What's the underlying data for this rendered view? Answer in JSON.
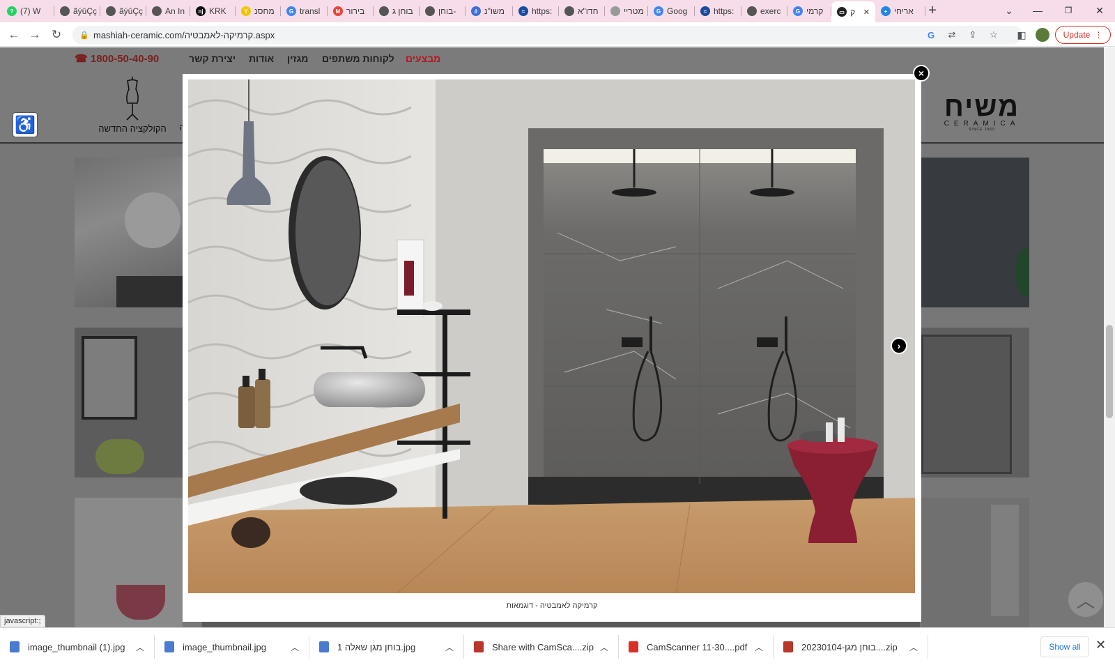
{
  "tabs": [
    {
      "title": "(7) W",
      "color": "#25d366",
      "glyph": "?"
    },
    {
      "title": "ãýûÇç",
      "color": "#555555",
      "glyph": ""
    },
    {
      "title": "ãýûÇç",
      "color": "#555555",
      "glyph": ""
    },
    {
      "title": "An In",
      "color": "#555555",
      "glyph": ""
    },
    {
      "title": "KRK",
      "color": "#111111",
      "glyph": "nj"
    },
    {
      "title": "מחסנ",
      "color": "#f2c500",
      "glyph": "Y"
    },
    {
      "title": "transl",
      "color": "#4285f4",
      "glyph": "G"
    },
    {
      "title": "בירור",
      "color": "#ea4335",
      "glyph": "M"
    },
    {
      "title": "בוחן ג",
      "color": "#555555",
      "glyph": ""
    },
    {
      "title": "בוחן-",
      "color": "#555555",
      "glyph": ""
    },
    {
      "title": "משו\"נ",
      "color": "#3f6fd8",
      "glyph": "∂"
    },
    {
      "title": "https:",
      "color": "#1a4b9c",
      "glyph": "≈"
    },
    {
      "title": "חדו\"א",
      "color": "#555555",
      "glyph": ""
    },
    {
      "title": "מטריי",
      "color": "#999999",
      "glyph": ""
    },
    {
      "title": "Goog",
      "color": "#4285f4",
      "glyph": "G"
    },
    {
      "title": "https:",
      "color": "#1a4b9c",
      "glyph": "≈"
    },
    {
      "title": "exerc",
      "color": "#555555",
      "glyph": ""
    },
    {
      "title": "קרמי",
      "color": "#4285f4",
      "glyph": "G"
    },
    {
      "title": "ק",
      "color": "#222222",
      "glyph": "▭",
      "active": true
    },
    {
      "title": "אריחי",
      "color": "#1e88e5",
      "glyph": "+"
    }
  ],
  "window": {
    "new_tab": "+",
    "tab_list": "⌄",
    "minimize": "—",
    "maximize": "❐",
    "close": "✕"
  },
  "browser": {
    "url": "mashiah-ceramic.com/קרמיקה-לאמבטיה.aspx",
    "update_label": "Update",
    "status_text": "javascript:;"
  },
  "site": {
    "phone": "☎ 1800-50-40-90",
    "nav": [
      "יצירת קשר",
      "אודות",
      "מגזין",
      "לקוחות משתפים",
      "מבצעים"
    ],
    "nav_highlight_color": "#b5171d",
    "collection_label": "הקולקציה החדשה",
    "logo_text": "משיח",
    "logo_sub": "CERAMICA",
    "logo_since": "SINCE 1960",
    "peek_char": "ה"
  },
  "lightbox": {
    "caption": "קרמיקה לאמבטיה - דוגמאות",
    "close_icon": "×",
    "next_icon": "›"
  },
  "downloads": {
    "items": [
      {
        "name": "image_thumbnail (1).jpg",
        "type": "jpg"
      },
      {
        "name": "image_thumbnail.jpg",
        "type": "jpg"
      },
      {
        "name": "בוחן מגן שאלה 1.jpg",
        "type": "jpg"
      },
      {
        "name": "Share with CamSca....zip",
        "type": "zip"
      },
      {
        "name": "CamScanner 11-30....pdf",
        "type": "pdf"
      },
      {
        "name": "20230104-בוחן מגן....zip",
        "type": "zip"
      }
    ],
    "show_all": "Show all",
    "close_icon": "✕"
  }
}
